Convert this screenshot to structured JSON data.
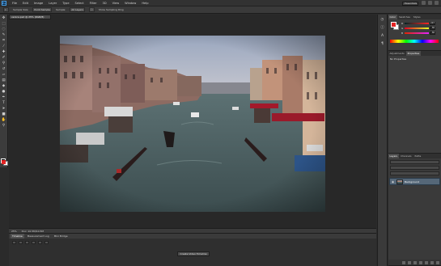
{
  "app": {
    "logo": "Ps",
    "menu": [
      "File",
      "Edit",
      "Image",
      "Layer",
      "Type",
      "Select",
      "Filter",
      "3D",
      "View",
      "Window",
      "Help"
    ],
    "workspace": "Essentials"
  },
  "options_bar": {
    "tool": "Eyedropper",
    "sample_size_label": "Sample Size:",
    "sample_size_value": "Point Sample",
    "sample_label": "Sample:",
    "sample_value": "All Layers",
    "show_sampling_ring": "Show Sampling Ring"
  },
  "document": {
    "tab_title": "venice.psd @ 25% (RGB/8)",
    "zoom": "25%",
    "doc_info": "Doc: 10.5M/10.5M"
  },
  "timeline": {
    "tabs": [
      "Timeline",
      "Measurement Log",
      "Mini Bridge"
    ],
    "create_button": "Create Video Timeline"
  },
  "color_panel": {
    "tabs": [
      "Color",
      "Swatches",
      "Styles"
    ],
    "fg_color": "#e32424",
    "bg_color": "#ffffff",
    "r": "227",
    "g": "36",
    "b": "36"
  },
  "properties_panel": {
    "tabs": [
      "Adjustments",
      "Properties"
    ],
    "title": "No Properties"
  },
  "layers_panel": {
    "tabs": [
      "Layers",
      "Channels",
      "Paths"
    ],
    "layer_name": "Background"
  },
  "tools": [
    "move-icon",
    "marquee-icon",
    "lasso-icon",
    "quick-select-icon",
    "crop-icon",
    "eyedropper-icon",
    "healing-icon",
    "brush-icon",
    "clone-stamp-icon",
    "history-brush-icon",
    "eraser-icon",
    "gradient-icon",
    "blur-icon",
    "dodge-icon",
    "pen-icon",
    "type-icon",
    "path-select-icon",
    "shape-icon",
    "hand-icon",
    "zoom-icon"
  ]
}
